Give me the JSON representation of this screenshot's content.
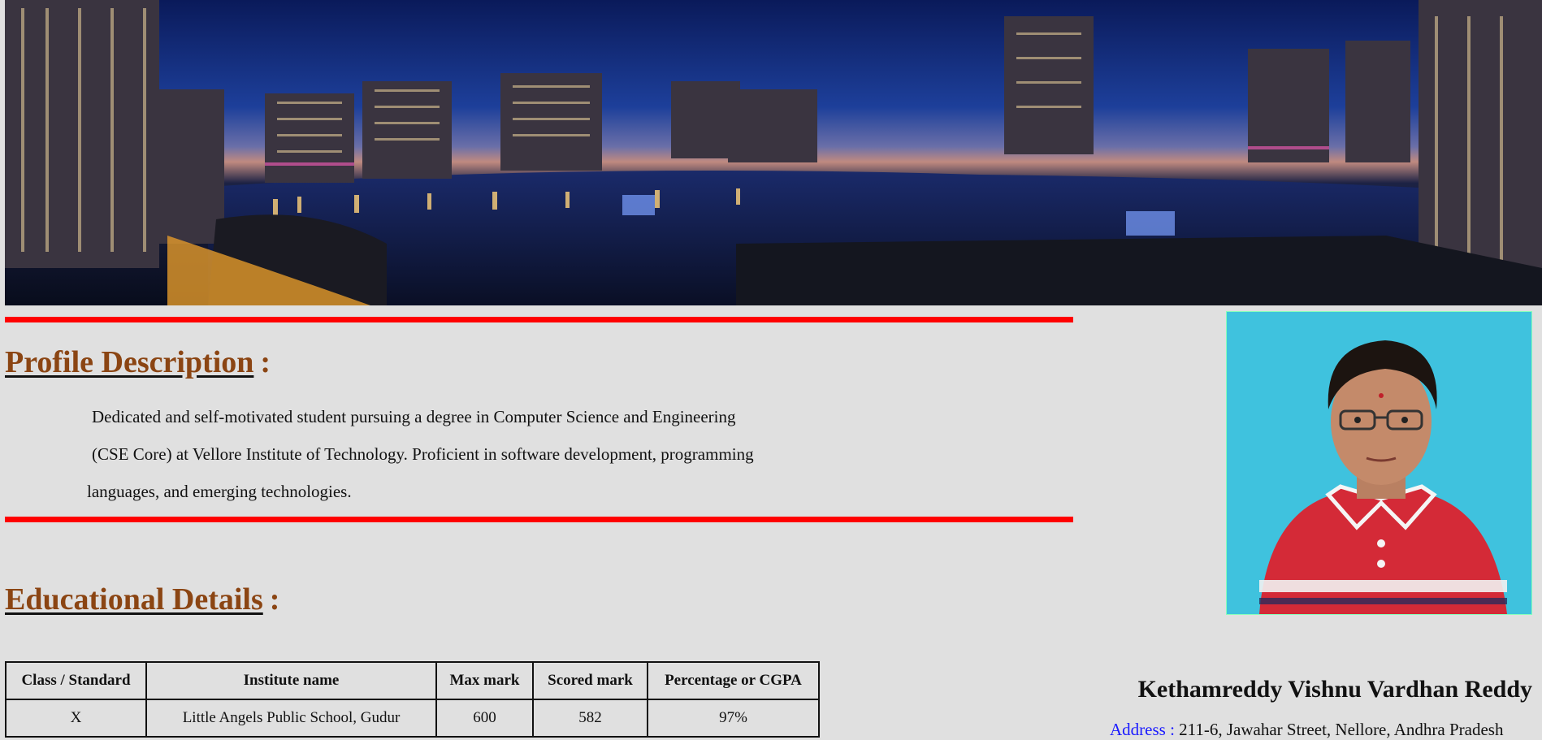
{
  "banner": {
    "alt": "city skyline at night"
  },
  "profile": {
    "heading": "Profile Description",
    "colon": ":",
    "lines": [
      "Dedicated and self-motivated student pursuing a degree in Computer Science and Engineering",
      "(CSE Core) at Vellore Institute of Technology. Proficient in software development, programming",
      "languages, and emerging technologies."
    ]
  },
  "education": {
    "heading": "Educational Details",
    "colon": ":",
    "columns": [
      "Class / Standard",
      "Institute name",
      "Max mark",
      "Scored mark",
      "Percentage or CGPA"
    ],
    "rows": [
      [
        "X",
        "Little Angels Public School, Gudur",
        "600",
        "582",
        "97%"
      ]
    ]
  },
  "person": {
    "name": "Kethamreddy Vishnu Vardhan Reddy",
    "address_label": "Address :",
    "address_value": "211-6, Jawahar Street, Nellore, Andhra Pradesh"
  },
  "colors": {
    "heading": "#8b4513",
    "rule": "#ff0000",
    "address_label": "#1a1aff",
    "background": "#e0e0e0"
  }
}
